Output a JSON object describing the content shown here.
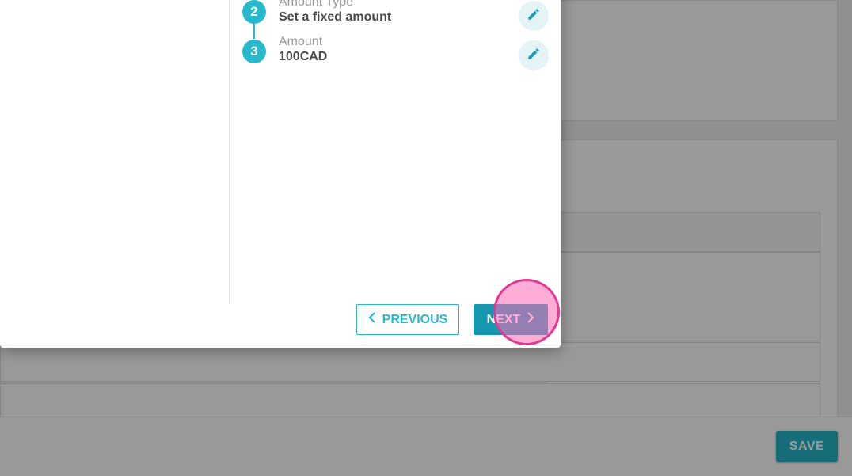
{
  "steps": [
    {
      "number": "2",
      "label": "Amount Type",
      "value": "Set a fixed amount"
    },
    {
      "number": "3",
      "label": "Amount",
      "value": "100CAD"
    }
  ],
  "buttons": {
    "previous_label": "PREVIOUS",
    "next_label": "NEXT",
    "save_label": "SAVE"
  },
  "icons": {
    "edit": "pencil-icon",
    "previous": "chevron-left-icon",
    "next": "chevron-right-icon"
  },
  "colors": {
    "accent": "#28b8cc",
    "next_button": "#1598b0",
    "click_marker": "#e23a92"
  }
}
